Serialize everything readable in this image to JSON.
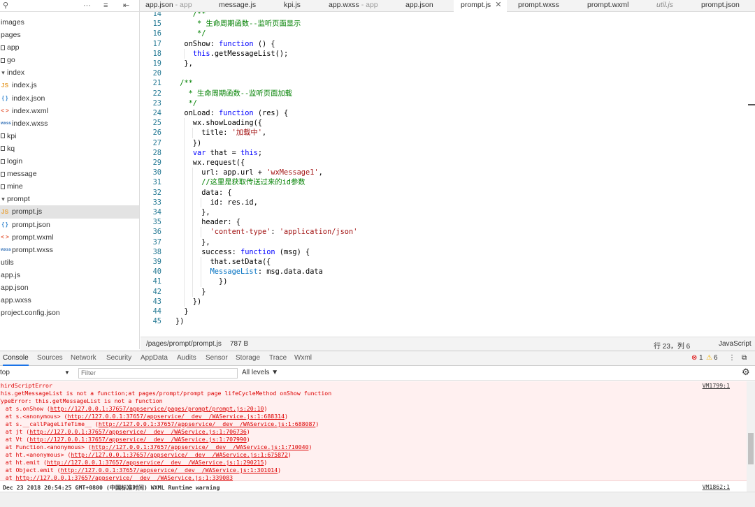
{
  "sidebar": {
    "toolbar": {
      "search_icon": "⚲",
      "more_icon": "···",
      "list_icon": "≡",
      "collapse_icon": "⇤"
    },
    "items": [
      {
        "label": "images",
        "type": "folder-root",
        "depth": 0
      },
      {
        "label": "pages",
        "type": "folder-root",
        "depth": 0
      },
      {
        "label": "app",
        "type": "folder-closed",
        "depth": 0
      },
      {
        "label": "go",
        "type": "folder-closed",
        "depth": 0
      },
      {
        "label": "index",
        "type": "folder-open",
        "depth": 0
      },
      {
        "label": "index.js",
        "type": "js",
        "depth": 0
      },
      {
        "label": "index.json",
        "type": "json",
        "depth": 0
      },
      {
        "label": "index.wxml",
        "type": "wxml",
        "depth": 0
      },
      {
        "label": "index.wxss",
        "type": "wxss",
        "depth": 0
      },
      {
        "label": "kpi",
        "type": "folder-closed",
        "depth": 0
      },
      {
        "label": "kq",
        "type": "folder-closed",
        "depth": 0
      },
      {
        "label": "login",
        "type": "folder-closed",
        "depth": 0
      },
      {
        "label": "message",
        "type": "folder-closed",
        "depth": 0
      },
      {
        "label": "mine",
        "type": "folder-closed",
        "depth": 0
      },
      {
        "label": "prompt",
        "type": "folder-open",
        "depth": 0
      },
      {
        "label": "prompt.js",
        "type": "js",
        "depth": 0,
        "selected": true
      },
      {
        "label": "prompt.json",
        "type": "json",
        "depth": 0
      },
      {
        "label": "prompt.wxml",
        "type": "wxml",
        "depth": 0
      },
      {
        "label": "prompt.wxss",
        "type": "wxss",
        "depth": 0
      },
      {
        "label": "utils",
        "type": "folder-root",
        "depth": 0
      },
      {
        "label": "app.js",
        "type": "plain",
        "depth": 0
      },
      {
        "label": "app.json",
        "type": "plain",
        "depth": 0
      },
      {
        "label": "app.wxss",
        "type": "plain",
        "depth": 0
      },
      {
        "label": "project.config.json",
        "type": "plain",
        "depth": 0
      }
    ],
    "icon_glyphs": {
      "js": "JS",
      "json": "{ }",
      "wxml": "< >",
      "wxss": "wxss",
      "folder-open": "▾"
    }
  },
  "tabs": [
    {
      "label": "app.json",
      "suffix": " - app"
    },
    {
      "label": "message.js",
      "suffix": ""
    },
    {
      "label": "kpi.js",
      "suffix": ""
    },
    {
      "label": "app.wxss",
      "suffix": " - app"
    },
    {
      "label": "app.json",
      "suffix": ""
    },
    {
      "label": "prompt.js",
      "suffix": "",
      "active": true,
      "close": "✕"
    },
    {
      "label": "prompt.wxss",
      "suffix": ""
    },
    {
      "label": "prompt.wxml",
      "suffix": ""
    },
    {
      "label": "util.js",
      "suffix": "",
      "italic": true
    },
    {
      "label": "prompt.json",
      "suffix": ""
    }
  ],
  "editor": {
    "lines": [
      {
        "n": "14",
        "t": [
          [
            "    /**",
            "c-cm"
          ]
        ],
        "ind": 1
      },
      {
        "n": "15",
        "t": [
          [
            "     * 生命周期函数--监听页面显示",
            "c-cm"
          ]
        ],
        "ind": 1
      },
      {
        "n": "16",
        "t": [
          [
            "     */",
            "c-cm"
          ]
        ],
        "ind": 1
      },
      {
        "n": "17",
        "t": [
          [
            "  onShow",
            ""
          ],
          [
            ": ",
            ""
          ],
          [
            "function",
            "c-kw"
          ],
          [
            " () {",
            ""
          ]
        ],
        "ind": 1
      },
      {
        "n": "18",
        "t": [
          [
            "    ",
            ""
          ],
          [
            "this",
            "c-kw"
          ],
          [
            ".getMessageList();",
            ""
          ]
        ],
        "ind": 2
      },
      {
        "n": "19",
        "t": [
          [
            "  },",
            ""
          ]
        ],
        "ind": 1
      },
      {
        "n": "20",
        "t": [
          [
            "",
            ""
          ]
        ],
        "ind": 1
      },
      {
        "n": "21",
        "t": [
          [
            " /**",
            "c-cm"
          ]
        ],
        "ind": 0
      },
      {
        "n": "22",
        "t": [
          [
            "   * 生命周期函数--监听页面加载",
            "c-cm"
          ]
        ],
        "ind": 1
      },
      {
        "n": "23",
        "t": [
          [
            "   */",
            "c-cm"
          ]
        ],
        "ind": 1
      },
      {
        "n": "24",
        "t": [
          [
            "  onLoad",
            ""
          ],
          [
            ": ",
            ""
          ],
          [
            "function",
            "c-kw"
          ],
          [
            " (res) {",
            ""
          ]
        ],
        "ind": 1
      },
      {
        "n": "25",
        "t": [
          [
            "    wx.showLoading({",
            ""
          ]
        ],
        "ind": 2
      },
      {
        "n": "26",
        "t": [
          [
            "      title",
            ""
          ],
          [
            ": ",
            ""
          ],
          [
            "'加载中'",
            "c-str"
          ],
          [
            ",",
            ""
          ]
        ],
        "ind": 3
      },
      {
        "n": "27",
        "t": [
          [
            "    })",
            ""
          ]
        ],
        "ind": 2
      },
      {
        "n": "28",
        "t": [
          [
            "    ",
            ""
          ],
          [
            "var",
            "c-kw"
          ],
          [
            " that = ",
            ""
          ],
          [
            "this",
            "c-kw"
          ],
          [
            ";",
            ""
          ]
        ],
        "ind": 2
      },
      {
        "n": "29",
        "t": [
          [
            "    wx.request({",
            ""
          ]
        ],
        "ind": 2
      },
      {
        "n": "30",
        "t": [
          [
            "      url",
            ""
          ],
          [
            ": app.url + ",
            ""
          ],
          [
            "'wxMessage1'",
            "c-str"
          ],
          [
            ",",
            ""
          ]
        ],
        "ind": 3
      },
      {
        "n": "31",
        "t": [
          [
            "      //这里是获取传送过来的id参数",
            "c-cm"
          ]
        ],
        "ind": 3
      },
      {
        "n": "32",
        "t": [
          [
            "      data",
            ""
          ],
          [
            ": {",
            ""
          ]
        ],
        "ind": 3
      },
      {
        "n": "33",
        "t": [
          [
            "        id",
            ""
          ],
          [
            ": res.id,",
            ""
          ]
        ],
        "ind": 4
      },
      {
        "n": "34",
        "t": [
          [
            "      },",
            ""
          ]
        ],
        "ind": 3
      },
      {
        "n": "35",
        "t": [
          [
            "      header",
            ""
          ],
          [
            ": {",
            ""
          ]
        ],
        "ind": 3
      },
      {
        "n": "36",
        "t": [
          [
            "        ",
            ""
          ],
          [
            "'content-type'",
            "c-str"
          ],
          [
            ": ",
            ""
          ],
          [
            "'application/json'",
            "c-str"
          ]
        ],
        "ind": 4
      },
      {
        "n": "37",
        "t": [
          [
            "      },",
            ""
          ]
        ],
        "ind": 3
      },
      {
        "n": "38",
        "t": [
          [
            "      success",
            ""
          ],
          [
            ": ",
            ""
          ],
          [
            "function",
            "c-kw"
          ],
          [
            " (msg) {",
            ""
          ]
        ],
        "ind": 3
      },
      {
        "n": "39",
        "t": [
          [
            "        that.setData({",
            ""
          ]
        ],
        "ind": 4
      },
      {
        "n": "40",
        "t": [
          [
            "        ",
            ""
          ],
          [
            "MessageList",
            "c-prop"
          ],
          [
            ": msg.data.data",
            ""
          ]
        ],
        "ind": 4
      },
      {
        "n": "41",
        "t": [
          [
            "          })",
            ""
          ]
        ],
        "ind": 4
      },
      {
        "n": "42",
        "t": [
          [
            "      }",
            ""
          ]
        ],
        "ind": 3
      },
      {
        "n": "43",
        "t": [
          [
            "    })",
            ""
          ]
        ],
        "ind": 2
      },
      {
        "n": "44",
        "t": [
          [
            "  }",
            ""
          ]
        ],
        "ind": 1
      },
      {
        "n": "45",
        "t": [
          [
            "})",
            ""
          ]
        ],
        "ind": 0
      }
    ]
  },
  "statusbar": {
    "path": "/pages/prompt/prompt.js",
    "size": "787 B",
    "position": "行 23，列 6",
    "language": "JavaScript"
  },
  "devtools": {
    "tabs": [
      "Console",
      "Sources",
      "Network",
      "Security",
      "AppData",
      "Audits",
      "Sensor",
      "Storage",
      "Trace",
      "Wxml"
    ],
    "active_tab": "Console",
    "error_count": "1",
    "warning_count": "6",
    "error_icon": "⊗",
    "warning_icon": "⚠",
    "more_icon": "⋮",
    "dock_icon": "⧉",
    "settings_icon": "⚙",
    "context_select": "top",
    "filter_placeholder": "Filter",
    "levels": "All levels ▼",
    "error_lines": [
      {
        "text": "thirdScriptError",
        "link": "",
        "src": "VM1799:1"
      },
      {
        "text": "this.getMessageList is not a function;at pages/prompt/prompt page lifeCycleMethod onShow function",
        "link": "",
        "src": ""
      },
      {
        "text": "TypeError: this.getMessageList is not a function",
        "link": "",
        "src": ""
      },
      {
        "text": "    at s.onShow (",
        "link": "http://127.0.0.1:37657/appservice/pages/prompt/prompt.js:20:10",
        "tail": ")",
        "src": ""
      },
      {
        "text": "    at s.<anonymous> (",
        "link": "http://127.0.0.1:37657/appservice/__dev__/WAService.js:1:688314",
        "tail": ")",
        "src": ""
      },
      {
        "text": "    at s.__callPageLifeTime__ (",
        "link": "http://127.0.0.1:37657/appservice/__dev__/WAService.js:1:688087",
        "tail": ")",
        "src": ""
      },
      {
        "text": "    at jt (",
        "link": "http://127.0.0.1:37657/appservice/__dev__/WAService.js:1:706736",
        "tail": ")",
        "src": ""
      },
      {
        "text": "    at Vt (",
        "link": "http://127.0.0.1:37657/appservice/__dev__/WAService.js:1:707990",
        "tail": ")",
        "src": ""
      },
      {
        "text": "    at Function.<anonymous> (",
        "link": "http://127.0.0.1:37657/appservice/__dev__/WAService.js:1:710040",
        "tail": ")",
        "src": ""
      },
      {
        "text": "    at ht.<anonymous> (",
        "link": "http://127.0.0.1:37657/appservice/__dev__/WAService.js:1:675872",
        "tail": ")",
        "src": ""
      },
      {
        "text": "    at ht.emit (",
        "link": "http://127.0.0.1:37657/appservice/__dev__/WAService.js:1:290215",
        "tail": ")",
        "src": ""
      },
      {
        "text": "    at Object.emit (",
        "link": "http://127.0.0.1:37657/appservice/__dev__/WAService.js:1:301014",
        "tail": ")",
        "src": ""
      },
      {
        "text": "    at ",
        "link": "http://127.0.0.1:37657/appservice/__dev__/WAService.js:1:339083",
        "tail": "",
        "src": ""
      }
    ],
    "warning_text": "Dec 23 2018 20:54:25 GMT+0800 (中国标准时间) WXML Runtime warning",
    "warning_src": "VM1862:1",
    "colors": {
      "error_bg": "#fff0f0",
      "error_text": "#dd0000",
      "warning_badge": "#f4b400",
      "active_tab_underline": "#1a73e8"
    }
  }
}
